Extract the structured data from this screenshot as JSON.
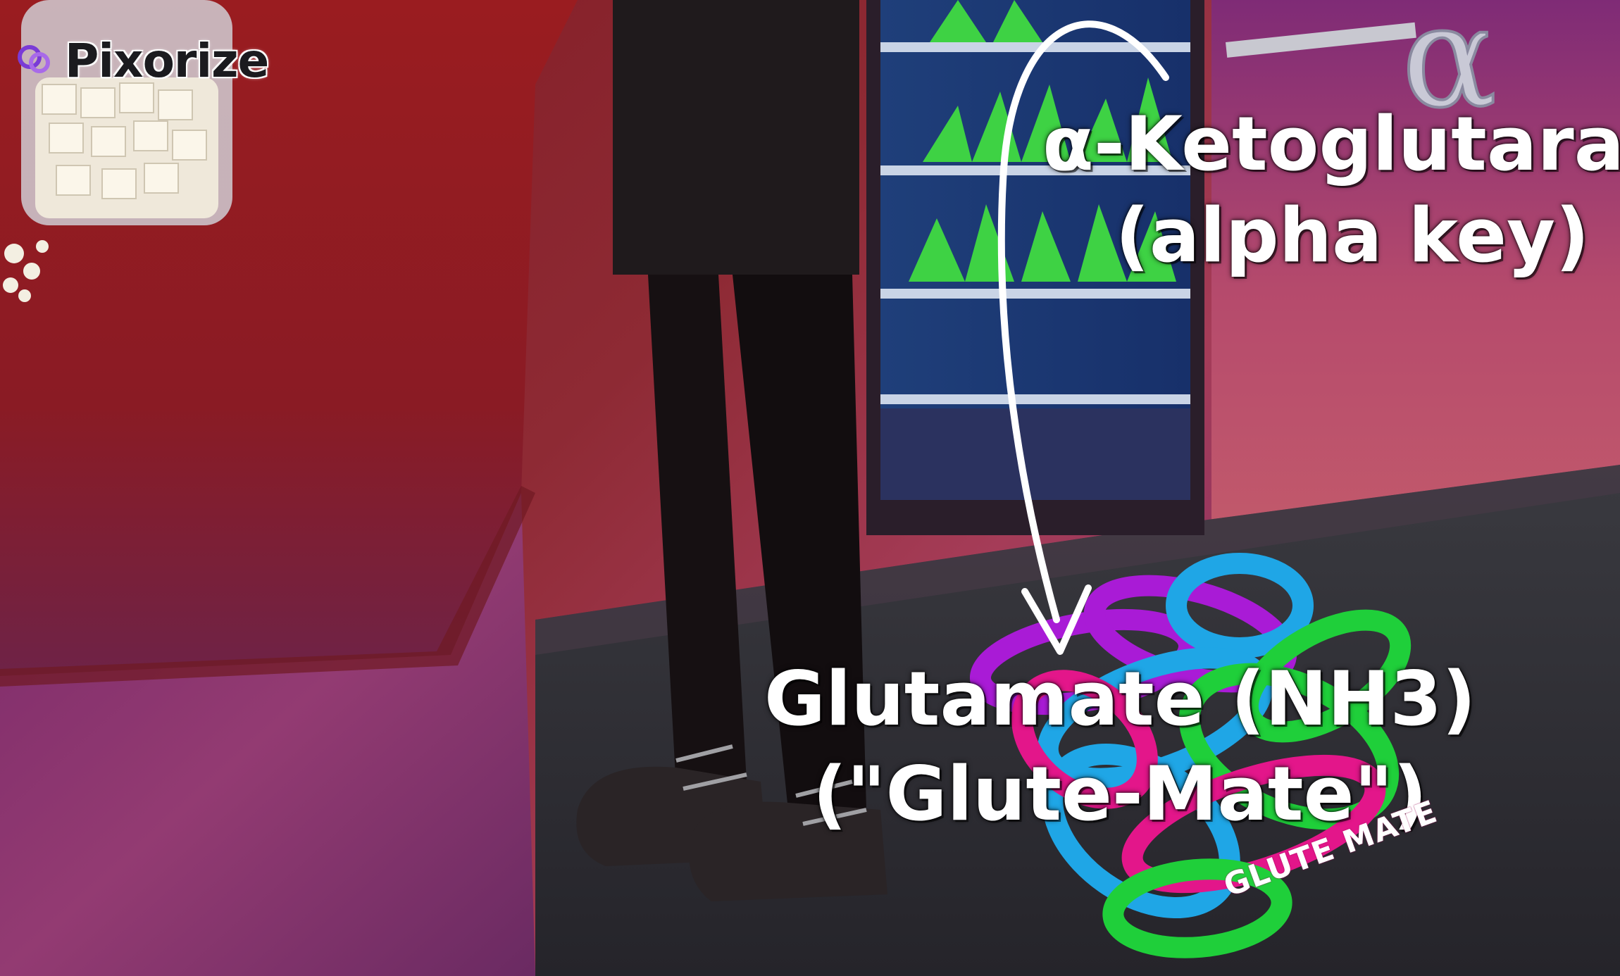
{
  "brand": {
    "name": "Pixorize",
    "logo_icon": "pixorize-logo-icon"
  },
  "labels": {
    "alpha_ketoglutarate": {
      "line1": "α-Ketoglutarate",
      "line2": "(alpha key)"
    },
    "glutamate": {
      "line1": "Glutamate (NH3)",
      "line2": "(\"Glute-Mate\")"
    }
  },
  "scene_text": {
    "band_tag": "GLUTE MATE"
  },
  "colors": {
    "background_red": "#8e1d26",
    "background_purple": "#6b2a6f",
    "label_text": "#ffffff",
    "band_pink": "#e3168a",
    "band_blue": "#1fa6e6",
    "band_green": "#1fcf3a",
    "band_purple": "#a91bd6"
  }
}
